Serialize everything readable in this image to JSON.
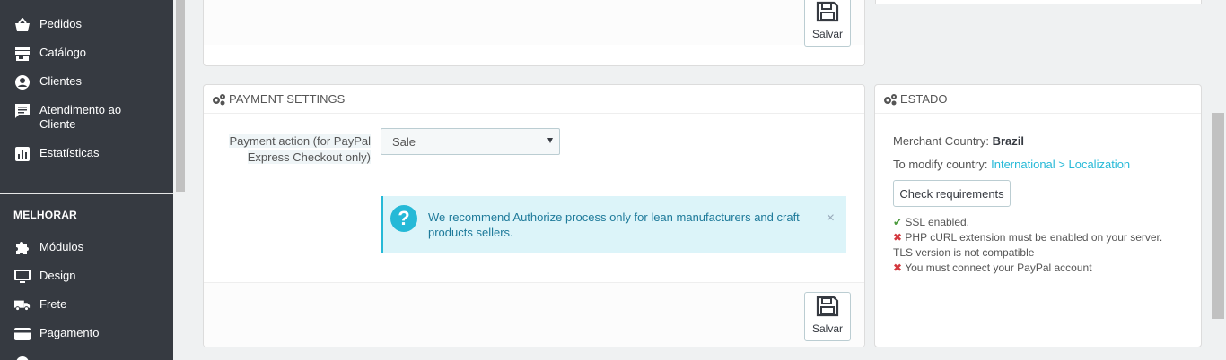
{
  "sidebar": {
    "items": [
      {
        "label": "Pedidos",
        "icon": "basket-icon"
      },
      {
        "label": "Catálogo",
        "icon": "store-icon"
      },
      {
        "label": "Clientes",
        "icon": "user-icon"
      },
      {
        "label": "Atendimento ao Cliente",
        "icon": "chat-icon"
      },
      {
        "label": "Estatísticas",
        "icon": "chart-icon"
      }
    ],
    "section_heading": "MELHORAR",
    "items2": [
      {
        "label": "Módulos",
        "icon": "puzzle-icon"
      },
      {
        "label": "Design",
        "icon": "monitor-icon"
      },
      {
        "label": "Frete",
        "icon": "truck-icon"
      },
      {
        "label": "Pagamento",
        "icon": "credit-card-icon"
      }
    ]
  },
  "top_panel": {
    "save_label": "Salvar"
  },
  "payment_settings": {
    "title": "PAYMENT SETTINGS",
    "field_label": "Payment action (for PayPal Express Checkout only)",
    "select_value": "Sale",
    "alert_text": "We recommend Authorize process only for lean manufacturers and craft products sellers.",
    "alert_close": "×",
    "save_label": "Salvar"
  },
  "estado": {
    "title": "ESTADO",
    "merchant_country_label": "Merchant Country:",
    "merchant_country_value": "Brazil",
    "modify_label": "To modify country:",
    "modify_link": "International > Localization",
    "check_button": "Check requirements",
    "status": [
      {
        "icon": "check-icon",
        "ok": true,
        "text": "SSL enabled."
      },
      {
        "icon": "cross-icon",
        "ok": false,
        "text": "PHP cURL extension must be enabled on your server."
      },
      {
        "icon": "",
        "ok": false,
        "text": "TLS version is not compatible"
      },
      {
        "icon": "cross-icon",
        "ok": false,
        "text": "You must connect your PayPal account"
      }
    ]
  },
  "colors": {
    "accent": "#25b9d7",
    "sidebar_bg": "#363a41",
    "ok": "#4a9a3c",
    "error": "#d3383e"
  }
}
